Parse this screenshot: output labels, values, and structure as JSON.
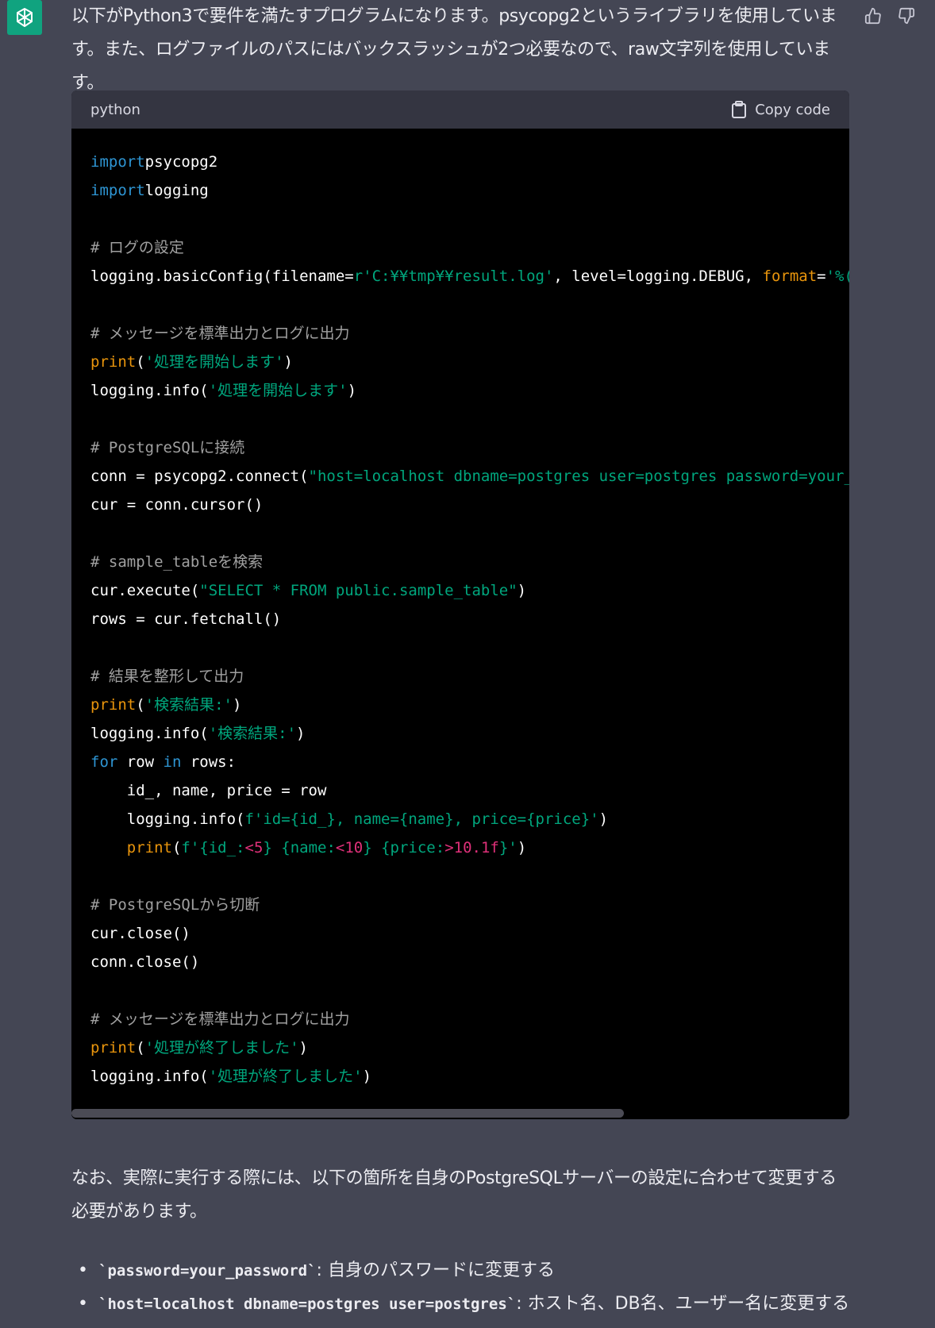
{
  "message": {
    "intro": "以下がPython3で要件を満たすプログラムになります。psycopg2というライブラリを使用しています。また、ログファイルのパスにはバックスラッシュが2つ必要なので、raw文字列を使用しています。",
    "code_language": "python",
    "copy_label": "Copy code",
    "note": "なお、実際に実行する際には、以下の箇所を自身のPostgreSQLサーバーの設定に合わせて変更する必要があります。",
    "bullets": [
      {
        "code": "`password=your_password`",
        "text": ": 自身のパスワードに変更する"
      },
      {
        "code": "`host=localhost dbname=postgres user=postgres`",
        "text": ": ホスト名、DB名、ユーザー名に変更する"
      }
    ]
  },
  "code_lines": [
    [
      [
        "kw",
        "import"
      ],
      [
        "",
        "psycopg2"
      ]
    ],
    [
      [
        "kw",
        "import"
      ],
      [
        "",
        "logging"
      ]
    ],
    [],
    [
      [
        "com",
        "# ログの設定"
      ]
    ],
    [
      [
        "",
        "logging.basicConfig(filename="
      ],
      [
        "str",
        "r'C:¥¥tmp¥¥result.log'"
      ],
      [
        "",
        ", level=logging.DEBUG, "
      ],
      [
        "bi",
        "format"
      ],
      [
        "",
        "="
      ],
      [
        "str",
        "'%(asc"
      ]
    ],
    [],
    [
      [
        "com",
        "# メッセージを標準出力とログに出力"
      ]
    ],
    [
      [
        "bi",
        "print"
      ],
      [
        "",
        "("
      ],
      [
        "str",
        "'処理を開始します'"
      ],
      [
        "",
        ")"
      ]
    ],
    [
      [
        "",
        "logging.info("
      ],
      [
        "str",
        "'処理を開始します'"
      ],
      [
        "",
        ")"
      ]
    ],
    [],
    [
      [
        "com",
        "# PostgreSQLに接続"
      ]
    ],
    [
      [
        "",
        "conn = psycopg2.connect("
      ],
      [
        "str",
        "\"host=localhost dbname=postgres user=postgres password=your_pas"
      ]
    ],
    [
      [
        "",
        "cur = conn.cursor()"
      ]
    ],
    [],
    [
      [
        "com",
        "# sample_tableを検索"
      ]
    ],
    [
      [
        "",
        "cur.execute("
      ],
      [
        "str",
        "\"SELECT * FROM public.sample_table\""
      ],
      [
        "",
        ")"
      ]
    ],
    [
      [
        "",
        "rows = cur.fetchall()"
      ]
    ],
    [],
    [
      [
        "com",
        "# 結果を整形して出力"
      ]
    ],
    [
      [
        "bi",
        "print"
      ],
      [
        "",
        "("
      ],
      [
        "str",
        "'検索結果:'"
      ],
      [
        "",
        ")"
      ]
    ],
    [
      [
        "",
        "logging.info("
      ],
      [
        "str",
        "'検索結果:'"
      ],
      [
        "",
        ")"
      ]
    ],
    [
      [
        "kw",
        "for"
      ],
      [
        "",
        " row "
      ],
      [
        "kw",
        "in"
      ],
      [
        "",
        " rows:"
      ]
    ],
    [
      [
        "",
        "    id_, name, price = row"
      ]
    ],
    [
      [
        "",
        "    logging.info("
      ],
      [
        "str",
        "f'id={id_}, name={name}, price={price}'"
      ],
      [
        "",
        ")"
      ]
    ],
    [
      [
        "",
        "    "
      ],
      [
        "bi",
        "print"
      ],
      [
        "",
        "("
      ],
      [
        "str",
        "f'{id_:"
      ],
      [
        "num",
        "<5"
      ],
      [
        "str",
        "} {name:"
      ],
      [
        "num",
        "<10"
      ],
      [
        "str",
        "} {price:"
      ],
      [
        "num",
        ">10.1f"
      ],
      [
        "str",
        "}'"
      ],
      [
        "",
        ")"
      ]
    ],
    [],
    [
      [
        "com",
        "# PostgreSQLから切断"
      ]
    ],
    [
      [
        "",
        "cur.close()"
      ]
    ],
    [
      [
        "",
        "conn.close()"
      ]
    ],
    [],
    [
      [
        "com",
        "# メッセージを標準出力とログに出力"
      ]
    ],
    [
      [
        "bi",
        "print"
      ],
      [
        "",
        "("
      ],
      [
        "str",
        "'処理が終了しました'"
      ],
      [
        "",
        ")"
      ]
    ],
    [
      [
        "",
        "logging.info("
      ],
      [
        "str",
        "'処理が終了しました'"
      ],
      [
        "",
        ")"
      ]
    ]
  ],
  "colors": {
    "background": "#444654",
    "avatar": "#10a37f",
    "code_bg": "#000000",
    "code_header": "#343541",
    "keyword": "#2e95d3",
    "string": "#00a67d",
    "comment": "#a0a0a0",
    "builtin": "#e9950c",
    "number": "#df3079"
  },
  "icons": {
    "avatar": "openai-logo-icon",
    "thumbs_up": "thumbs-up-icon",
    "thumbs_down": "thumbs-down-icon",
    "copy": "clipboard-icon"
  }
}
